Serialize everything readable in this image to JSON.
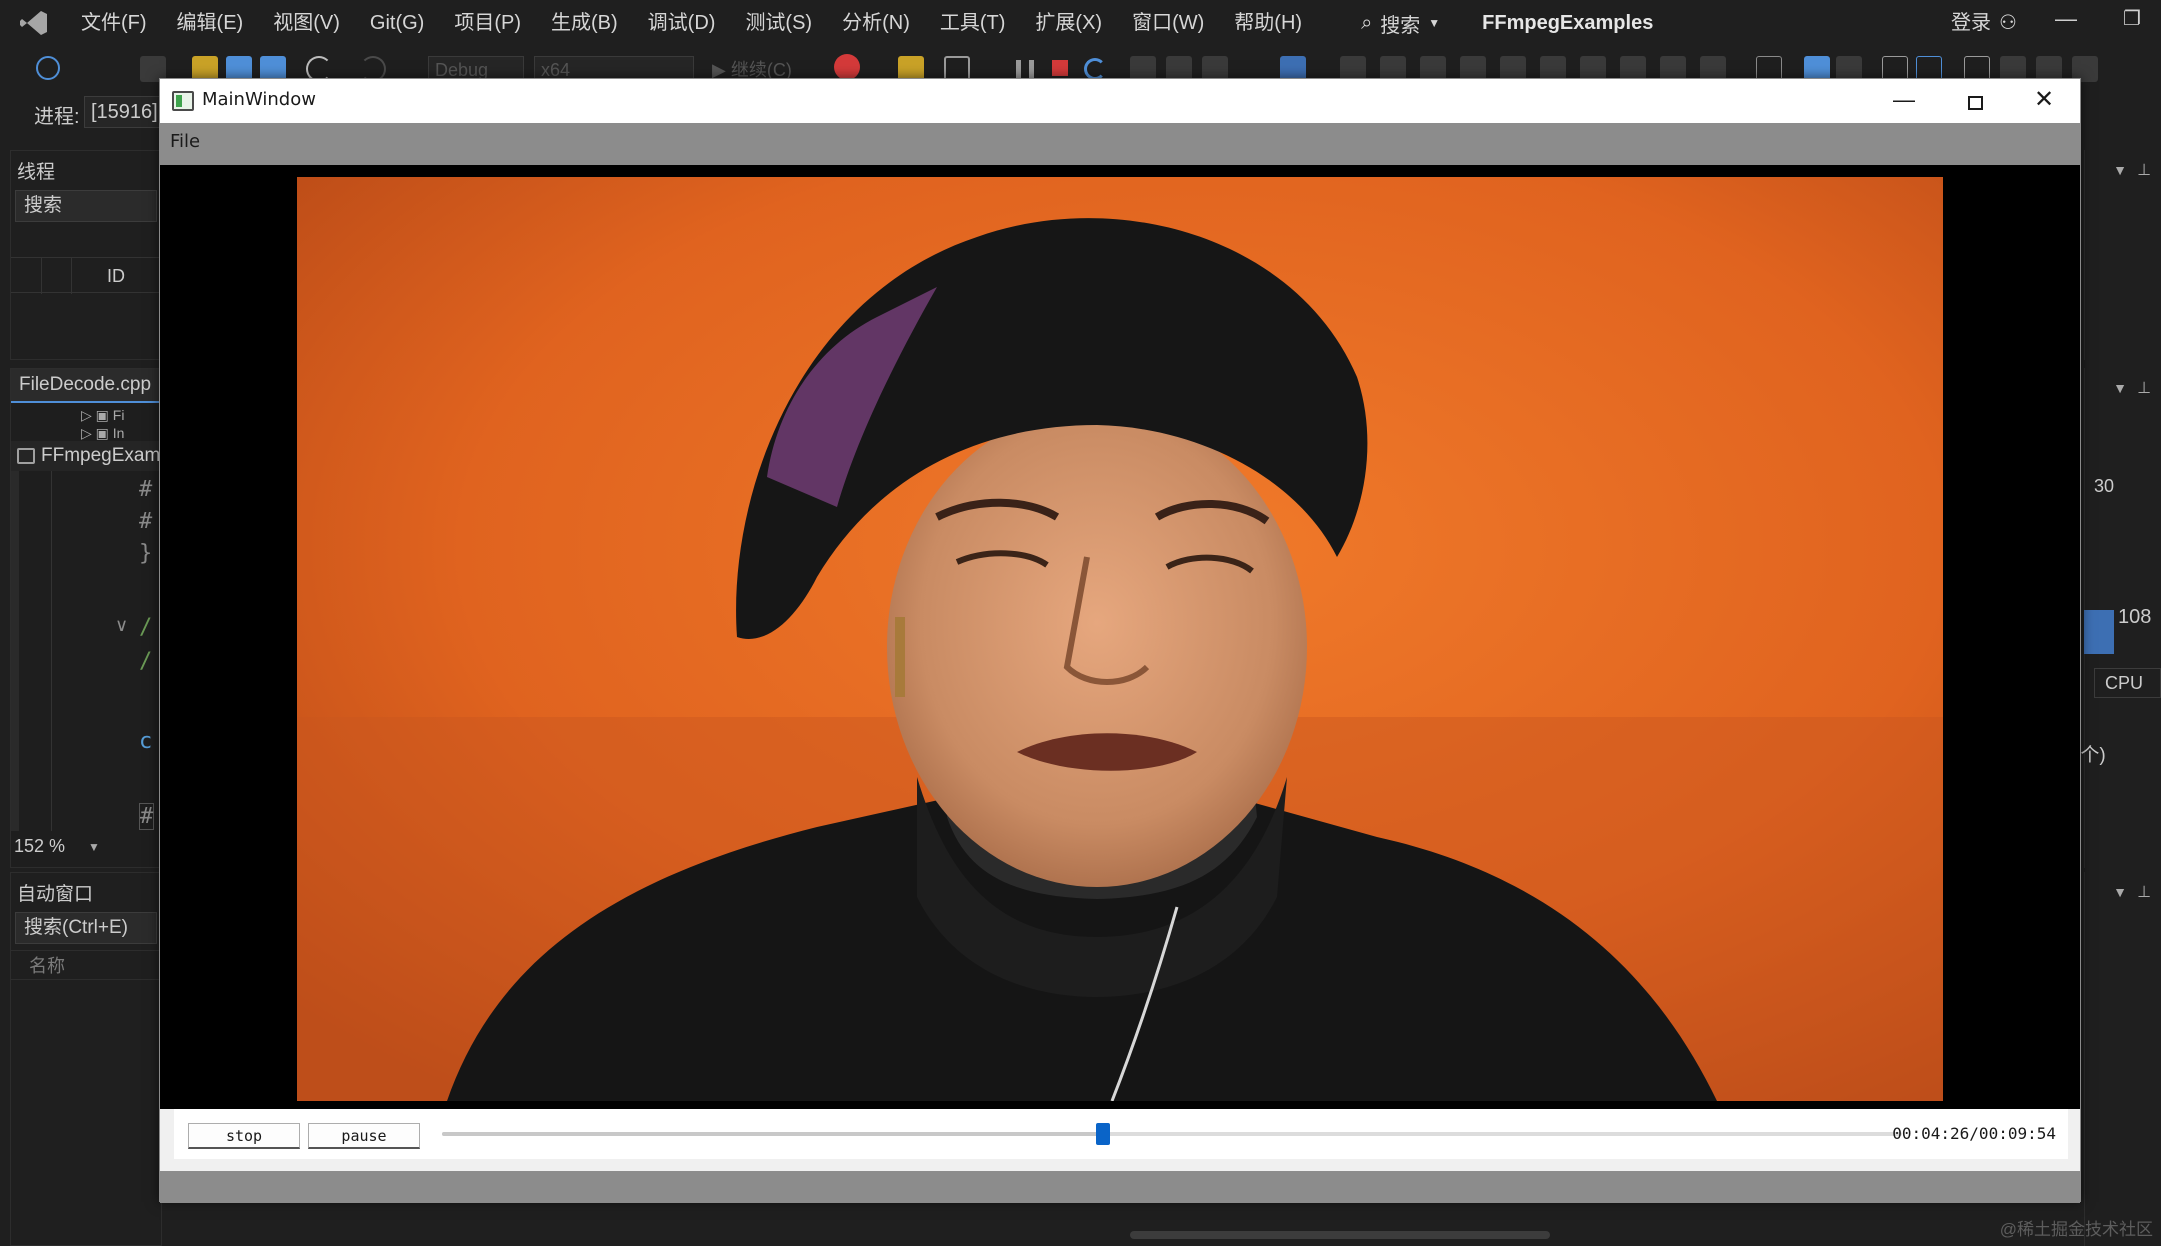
{
  "ide": {
    "menu": [
      "文件(F)",
      "编辑(E)",
      "视图(V)",
      "Git(G)",
      "项目(P)",
      "生成(B)",
      "调试(D)",
      "测试(S)",
      "分析(N)",
      "工具(T)",
      "扩展(X)",
      "窗口(W)",
      "帮助(H)"
    ],
    "search_label": "搜索",
    "solution_name": "FFmpegExamples",
    "login_label": "登录",
    "toolbar": {
      "config": "Debug",
      "platform": "x64",
      "continue_label": "继续(C)"
    },
    "process": {
      "label": "进程:",
      "value": "[15916]"
    },
    "threads_panel": {
      "title": "线程",
      "search_placeholder": "搜索",
      "column_id": "ID"
    },
    "editor": {
      "tab": "FileDecode.cpp",
      "nav": "FFmpegExam",
      "zoom": "152 %"
    },
    "autos_panel": {
      "title": "自动窗口",
      "search_placeholder": "搜索(Ctrl+E)",
      "column_name": "名称"
    },
    "right_panel": {
      "value_30": "30",
      "value_108": "108",
      "cpu_label": "CPU",
      "count_text": ")个)"
    },
    "watermark": "@稀土掘金技术社区"
  },
  "main_window": {
    "title": "MainWindow",
    "menu_file": "File",
    "stop_label": "stop",
    "pause_label": "pause",
    "position_fraction": 0.4525,
    "time_label": "00:04:26/00:09:54"
  },
  "colors": {
    "accent": "#0a64c8",
    "ide_bg": "#1f1f1f",
    "qt_menubar": "#8c8c8c",
    "video_bg": "#000000"
  },
  "icons": {
    "vs_logo": "visual-studio-icon",
    "search": "search-icon",
    "login": "account-icon",
    "app": "qt-window-icon"
  }
}
